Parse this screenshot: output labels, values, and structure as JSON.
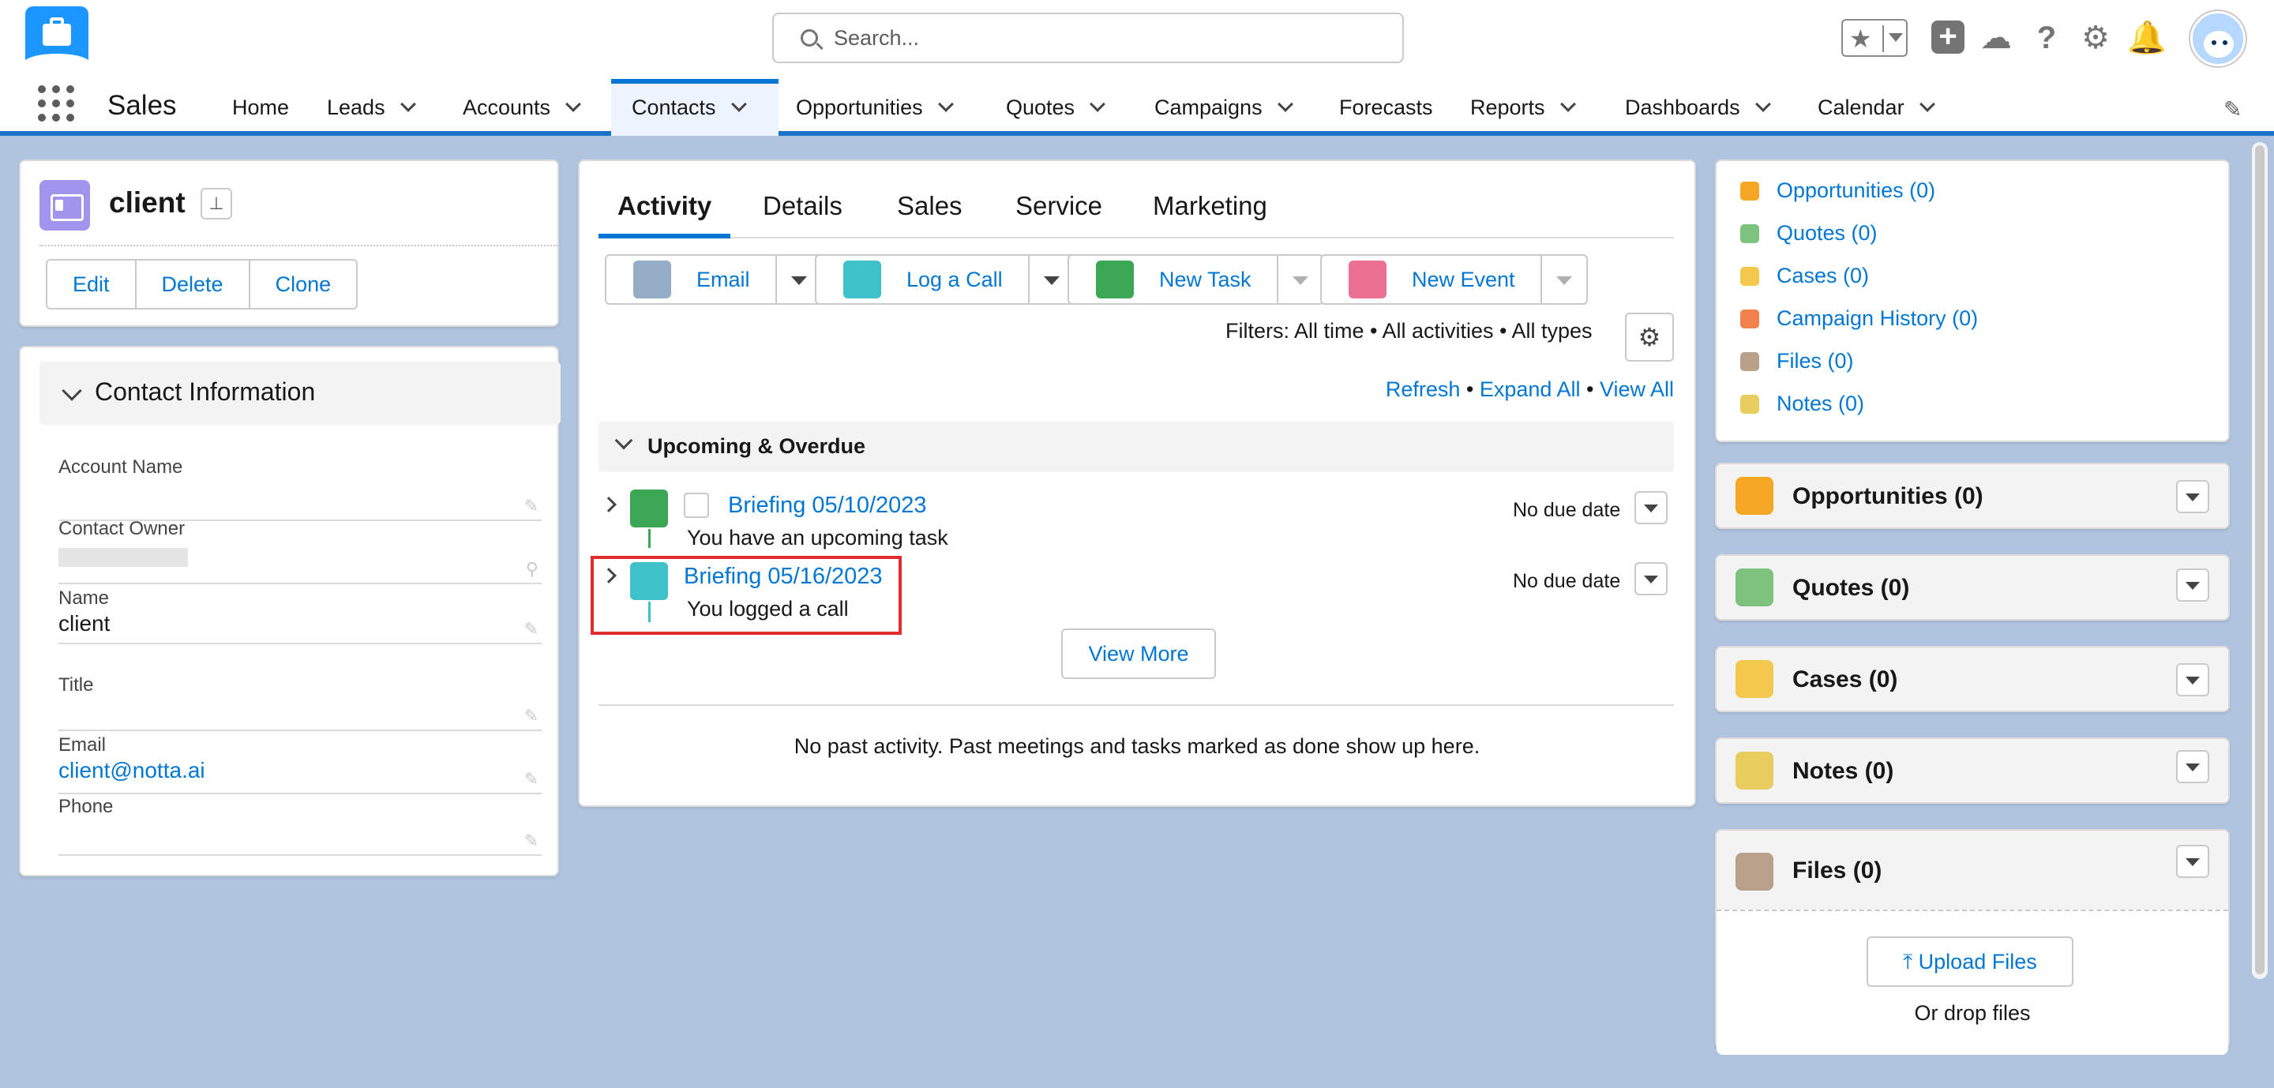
{
  "search": {
    "placeholder": "Search..."
  },
  "app": {
    "name": "Sales"
  },
  "nav": [
    {
      "label": "Home",
      "chevron": false
    },
    {
      "label": "Leads",
      "chevron": true
    },
    {
      "label": "Accounts",
      "chevron": true
    },
    {
      "label": "Contacts",
      "chevron": true,
      "active": true
    },
    {
      "label": "Opportunities",
      "chevron": true
    },
    {
      "label": "Quotes",
      "chevron": true
    },
    {
      "label": "Campaigns",
      "chevron": true
    },
    {
      "label": "Forecasts",
      "chevron": false
    },
    {
      "label": "Reports",
      "chevron": true
    },
    {
      "label": "Dashboards",
      "chevron": true
    },
    {
      "label": "Calendar",
      "chevron": true
    }
  ],
  "record": {
    "title": "client",
    "buttons": {
      "edit": "Edit",
      "delete": "Delete",
      "clone": "Clone"
    }
  },
  "contact_info": {
    "heading": "Contact Information",
    "fields": {
      "account_name": {
        "label": "Account Name",
        "value": ""
      },
      "contact_owner": {
        "label": "Contact Owner",
        "value": ""
      },
      "name": {
        "label": "Name",
        "value": "client"
      },
      "title": {
        "label": "Title",
        "value": ""
      },
      "email": {
        "label": "Email",
        "value": "client@notta.ai"
      },
      "phone": {
        "label": "Phone",
        "value": ""
      }
    }
  },
  "tabs": {
    "activity": "Activity",
    "details": "Details",
    "sales": "Sales",
    "service": "Service",
    "marketing": "Marketing"
  },
  "actions": {
    "email": "Email",
    "log_call": "Log a Call",
    "new_task": "New Task",
    "new_event": "New Event"
  },
  "filters": {
    "text": "Filters: All time • All activities • All types"
  },
  "activity_links": {
    "refresh": "Refresh",
    "expand_all": "Expand All",
    "view_all": "View All",
    "sep": "•"
  },
  "upcoming": {
    "heading": "Upcoming & Overdue",
    "items": [
      {
        "title": "Briefing 05/10/2023",
        "subtitle": "You have an upcoming task",
        "due": "No due date"
      },
      {
        "title": "Briefing 05/16/2023",
        "subtitle": "You logged a call",
        "due": "No due date"
      }
    ],
    "view_more": "View More"
  },
  "no_past": "No past activity. Past meetings and tasks marked as done show up here.",
  "related_links": [
    {
      "label": "Opportunities (0)",
      "color": "#f5a623"
    },
    {
      "label": "Quotes (0)",
      "color": "#7dc37d"
    },
    {
      "label": "Cases (0)",
      "color": "#f2c94c"
    },
    {
      "label": "Campaign History (0)",
      "color": "#f2814b"
    },
    {
      "label": "Files (0)",
      "color": "#b8a08b"
    },
    {
      "label": "Notes (0)",
      "color": "#e8cd5e"
    }
  ],
  "related_cards": {
    "opportunities": "Opportunities (0)",
    "quotes": "Quotes (0)",
    "cases": "Cases (0)",
    "notes": "Notes (0)",
    "files": "Files (0)",
    "upload": "Upload Files",
    "drop": "Or drop files"
  },
  "colors": {
    "brand": "#0176d3",
    "email_icon": "#95aec5",
    "call_icon": "#3ec1c9",
    "task_icon": "#3ba755",
    "event_icon": "#eb7092",
    "highlight": "#e22d2d"
  }
}
